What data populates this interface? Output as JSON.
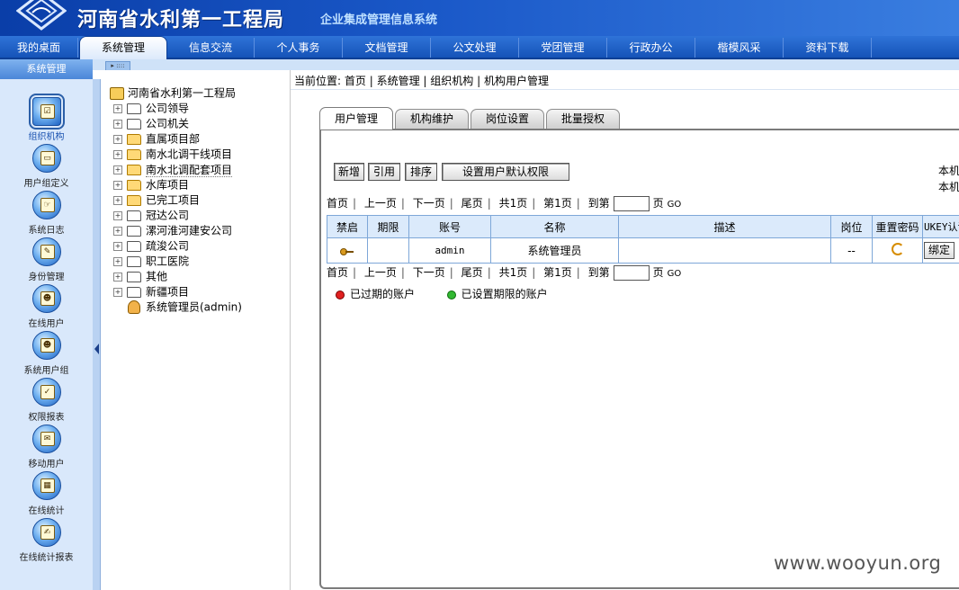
{
  "header": {
    "org_title": "河南省水利第一工程局",
    "system_title": "企业集成管理信息系统"
  },
  "topnav": {
    "tabs": [
      {
        "label": "我的桌面"
      },
      {
        "label": "系统管理",
        "active": true
      },
      {
        "label": "信息交流"
      },
      {
        "label": "个人事务"
      },
      {
        "label": "文档管理"
      },
      {
        "label": "公文处理"
      },
      {
        "label": "党团管理"
      },
      {
        "label": "行政办公"
      },
      {
        "label": "楷模风采"
      },
      {
        "label": "资料下载"
      }
    ]
  },
  "sidebar": {
    "header": "系统管理",
    "items": [
      {
        "label": "组织机构",
        "icon": "org-structure-icon",
        "active": true
      },
      {
        "label": "用户组定义",
        "icon": "user-group-icon"
      },
      {
        "label": "系统日志",
        "icon": "system-log-icon"
      },
      {
        "label": "身份管理",
        "icon": "identity-icon"
      },
      {
        "label": "在线用户",
        "icon": "online-users-icon"
      },
      {
        "label": "系统用户组",
        "icon": "system-user-group-icon"
      },
      {
        "label": "权限报表",
        "icon": "permission-report-icon"
      },
      {
        "label": "移动用户",
        "icon": "mobile-user-icon"
      },
      {
        "label": "在线统计",
        "icon": "online-stats-icon"
      },
      {
        "label": "在线统计报表",
        "icon": "online-stats-report-icon"
      }
    ]
  },
  "tree": {
    "root": "河南省水利第一工程局",
    "nodes": [
      {
        "label": "公司领导",
        "highlight": false
      },
      {
        "label": "公司机关",
        "highlight": false
      },
      {
        "label": "直属项目部",
        "highlight": true
      },
      {
        "label": "南水北调干线项目",
        "highlight": true
      },
      {
        "label": "南水北调配套项目",
        "highlight": true
      },
      {
        "label": "水库项目",
        "highlight": true
      },
      {
        "label": "已完工项目",
        "highlight": true
      },
      {
        "label": "冠达公司",
        "highlight": false
      },
      {
        "label": "漯河淮河建安公司",
        "highlight": false
      },
      {
        "label": "疏浚公司",
        "highlight": false
      },
      {
        "label": "职工医院",
        "highlight": false
      },
      {
        "label": "其他",
        "highlight": false
      },
      {
        "label": "新疆项目",
        "highlight": false
      }
    ],
    "user": "系统管理员(admin)"
  },
  "breadcrumb": {
    "prefix": "当前位置:",
    "items": [
      "首页",
      "系统管理",
      "组织机构",
      "机构用户管理"
    ]
  },
  "content_tabs": [
    {
      "label": "用户管理",
      "active": true
    },
    {
      "label": "机构维护"
    },
    {
      "label": "岗位设置"
    },
    {
      "label": "批量授权"
    }
  ],
  "toolbar": {
    "add": "新增",
    "reference": "引用",
    "sort": "排序",
    "default_perm": "设置用户默认权限"
  },
  "right_note": {
    "line1": "本机",
    "line2": "本机"
  },
  "pager": {
    "first": "首页",
    "prev": "上一页",
    "next": "下一页",
    "last": "尾页",
    "total": "共1页",
    "current": "第1页",
    "goto": "到第",
    "page_unit": "页",
    "go": "GO"
  },
  "table": {
    "columns": [
      "禁启",
      "期限",
      "账号",
      "名称",
      "描述",
      "岗位",
      "重置密码",
      "UKEY认证"
    ],
    "rows": [
      {
        "enable_icon": "key-icon",
        "term": "",
        "account": "admin",
        "name": "系统管理员",
        "desc": "",
        "post": "--",
        "reset_icon": "reset-password-icon",
        "bind": "绑定"
      }
    ]
  },
  "legend": {
    "expired": "已过期的账户",
    "term_set": "已设置期限的账户",
    "expired_color": "#e02020",
    "term_set_color": "#32b832"
  },
  "watermark": "www.wooyun.org"
}
